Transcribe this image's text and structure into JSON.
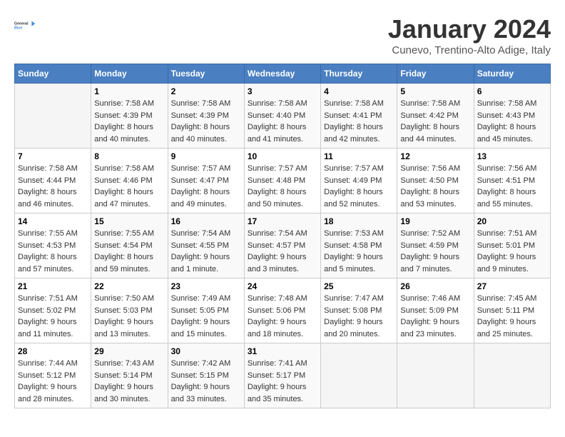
{
  "header": {
    "logo_line1": "General",
    "logo_line2": "Blue",
    "title": "January 2024",
    "subtitle": "Cunevo, Trentino-Alto Adige, Italy"
  },
  "days_of_week": [
    "Sunday",
    "Monday",
    "Tuesday",
    "Wednesday",
    "Thursday",
    "Friday",
    "Saturday"
  ],
  "weeks": [
    [
      {
        "day": "",
        "info": ""
      },
      {
        "day": "1",
        "sunrise": "7:58 AM",
        "sunset": "4:39 PM",
        "daylight": "8 hours and 40 minutes."
      },
      {
        "day": "2",
        "sunrise": "7:58 AM",
        "sunset": "4:39 PM",
        "daylight": "8 hours and 40 minutes."
      },
      {
        "day": "3",
        "sunrise": "7:58 AM",
        "sunset": "4:40 PM",
        "daylight": "8 hours and 41 minutes."
      },
      {
        "day": "4",
        "sunrise": "7:58 AM",
        "sunset": "4:41 PM",
        "daylight": "8 hours and 42 minutes."
      },
      {
        "day": "5",
        "sunrise": "7:58 AM",
        "sunset": "4:42 PM",
        "daylight": "8 hours and 44 minutes."
      },
      {
        "day": "6",
        "sunrise": "7:58 AM",
        "sunset": "4:43 PM",
        "daylight": "8 hours and 45 minutes."
      }
    ],
    [
      {
        "day": "7",
        "sunrise": "7:58 AM",
        "sunset": "4:44 PM",
        "daylight": "8 hours and 46 minutes."
      },
      {
        "day": "8",
        "sunrise": "7:58 AM",
        "sunset": "4:46 PM",
        "daylight": "8 hours and 47 minutes."
      },
      {
        "day": "9",
        "sunrise": "7:57 AM",
        "sunset": "4:47 PM",
        "daylight": "8 hours and 49 minutes."
      },
      {
        "day": "10",
        "sunrise": "7:57 AM",
        "sunset": "4:48 PM",
        "daylight": "8 hours and 50 minutes."
      },
      {
        "day": "11",
        "sunrise": "7:57 AM",
        "sunset": "4:49 PM",
        "daylight": "8 hours and 52 minutes."
      },
      {
        "day": "12",
        "sunrise": "7:56 AM",
        "sunset": "4:50 PM",
        "daylight": "8 hours and 53 minutes."
      },
      {
        "day": "13",
        "sunrise": "7:56 AM",
        "sunset": "4:51 PM",
        "daylight": "8 hours and 55 minutes."
      }
    ],
    [
      {
        "day": "14",
        "sunrise": "7:55 AM",
        "sunset": "4:53 PM",
        "daylight": "8 hours and 57 minutes."
      },
      {
        "day": "15",
        "sunrise": "7:55 AM",
        "sunset": "4:54 PM",
        "daylight": "8 hours and 59 minutes."
      },
      {
        "day": "16",
        "sunrise": "7:54 AM",
        "sunset": "4:55 PM",
        "daylight": "9 hours and 1 minute."
      },
      {
        "day": "17",
        "sunrise": "7:54 AM",
        "sunset": "4:57 PM",
        "daylight": "9 hours and 3 minutes."
      },
      {
        "day": "18",
        "sunrise": "7:53 AM",
        "sunset": "4:58 PM",
        "daylight": "9 hours and 5 minutes."
      },
      {
        "day": "19",
        "sunrise": "7:52 AM",
        "sunset": "4:59 PM",
        "daylight": "9 hours and 7 minutes."
      },
      {
        "day": "20",
        "sunrise": "7:51 AM",
        "sunset": "5:01 PM",
        "daylight": "9 hours and 9 minutes."
      }
    ],
    [
      {
        "day": "21",
        "sunrise": "7:51 AM",
        "sunset": "5:02 PM",
        "daylight": "9 hours and 11 minutes."
      },
      {
        "day": "22",
        "sunrise": "7:50 AM",
        "sunset": "5:03 PM",
        "daylight": "9 hours and 13 minutes."
      },
      {
        "day": "23",
        "sunrise": "7:49 AM",
        "sunset": "5:05 PM",
        "daylight": "9 hours and 15 minutes."
      },
      {
        "day": "24",
        "sunrise": "7:48 AM",
        "sunset": "5:06 PM",
        "daylight": "9 hours and 18 minutes."
      },
      {
        "day": "25",
        "sunrise": "7:47 AM",
        "sunset": "5:08 PM",
        "daylight": "9 hours and 20 minutes."
      },
      {
        "day": "26",
        "sunrise": "7:46 AM",
        "sunset": "5:09 PM",
        "daylight": "9 hours and 23 minutes."
      },
      {
        "day": "27",
        "sunrise": "7:45 AM",
        "sunset": "5:11 PM",
        "daylight": "9 hours and 25 minutes."
      }
    ],
    [
      {
        "day": "28",
        "sunrise": "7:44 AM",
        "sunset": "5:12 PM",
        "daylight": "9 hours and 28 minutes."
      },
      {
        "day": "29",
        "sunrise": "7:43 AM",
        "sunset": "5:14 PM",
        "daylight": "9 hours and 30 minutes."
      },
      {
        "day": "30",
        "sunrise": "7:42 AM",
        "sunset": "5:15 PM",
        "daylight": "9 hours and 33 minutes."
      },
      {
        "day": "31",
        "sunrise": "7:41 AM",
        "sunset": "5:17 PM",
        "daylight": "9 hours and 35 minutes."
      },
      {
        "day": "",
        "info": ""
      },
      {
        "day": "",
        "info": ""
      },
      {
        "day": "",
        "info": ""
      }
    ]
  ],
  "labels": {
    "sunrise": "Sunrise:",
    "sunset": "Sunset:",
    "daylight": "Daylight:"
  }
}
